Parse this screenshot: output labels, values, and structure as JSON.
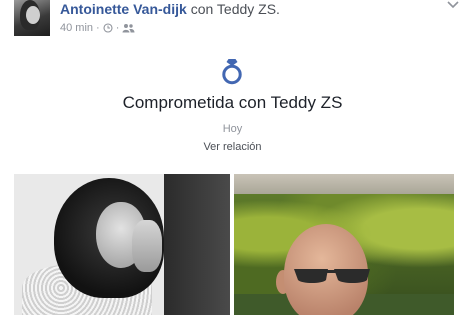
{
  "post": {
    "author": "Antoinette Van-dijk",
    "with_text": "con",
    "tagged": "Teddy ZS.",
    "time": "40 min",
    "separator": "·"
  },
  "life_event": {
    "icon": "ring-icon",
    "title": "Comprometida con Teddy ZS",
    "date": "Hoy",
    "link": "Ver relación"
  },
  "colors": {
    "link_blue": "#365899",
    "icon_blue": "#4267b2",
    "meta_gray": "#90949c"
  }
}
